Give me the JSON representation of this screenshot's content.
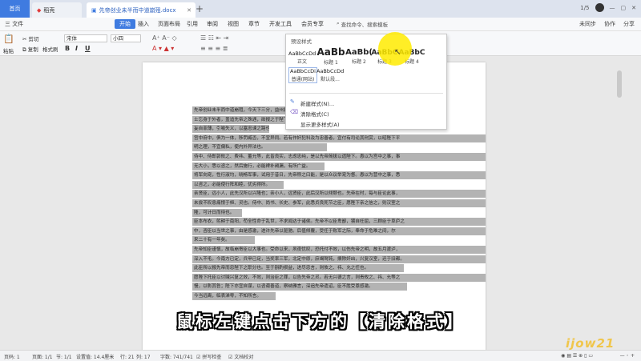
{
  "titlebar": {
    "home_tab": "首页",
    "docer_tab": "稻壳",
    "doc_tab": "先帝创业未半而中道崩殂.docx",
    "right_badge": "1/5",
    "sign_in": "(登录)"
  },
  "menubar": {
    "items": [
      "三 文件",
      "开始",
      "插入",
      "页面布局",
      "引用",
      "审阅",
      "视图",
      "章节",
      "开发工具",
      "会员专享"
    ],
    "search": "查找命令、搜索模板",
    "right": [
      "未同步",
      "协作",
      "分享"
    ]
  },
  "ribbon": {
    "cut": "剪切",
    "copy": "复制",
    "paste": "粘贴",
    "format_painter": "格式刷",
    "font_name": "宋体",
    "font_size": "小四",
    "bold": "B",
    "italic": "I",
    "underline": "U"
  },
  "styles_panel": {
    "header": "预设样式",
    "row1": [
      {
        "sample": "AaBbCcDd",
        "label": "正文"
      },
      {
        "sample": "AaBb",
        "label": "标题 1"
      },
      {
        "sample": "AaBb(",
        "label": "标题 2"
      },
      {
        "sample": "AaBbC",
        "label": "标题 3"
      },
      {
        "sample": "AaBbC",
        "label": "标题 4"
      }
    ],
    "row2": [
      {
        "sample": "AaBbCcDi",
        "label": "普通(网站)"
      },
      {
        "sample": "AaBbCcDd",
        "label": "默认段..."
      }
    ],
    "menu": [
      "新建样式(N)...",
      "清除格式(C)",
      "显示更多样式(A)"
    ]
  },
  "document": {
    "lines": [
      "先帝创业未半而中道崩殂，今天下三分，益州疲弊，此诚危急存",
      "士忘身于外者，盖追先帝之殊遇，欲报之于陛下也。诚宜开张圣听",
      "妄自菲薄，引喻失义，以塞忠谏之路也。",
      "宫中府中，俱为一体，陟罚臧否，不宜异同。若有作奸犯科及为忠善者，宜付有司论其刑赏，以昭陛下平",
      "明之理，不宜偏私，使内外异法也。",
      "侍中、侍郎郭攸之、费祎、董允等，此皆良实，志虑忠纯，是以先帝简拔以遗陛下。愚以为宫中之事，事",
      "无大小，悉以咨之，然后施行，必能裨补阙漏，有所广益。",
      "将军向宠，性行淑均，晓畅军事，试用于昔日，先帝称之曰能，是以众议举宠为督。愚以为营中之事，悉",
      "以咨之，必能使行阵和睦，优劣得所。",
      "亲贤臣，远小人，此先汉所以兴隆也；亲小人，远贤臣，此后汉所以倾颓也。先帝在时，每与臣论此事，",
      "未尝不叹息痛恨于桓、灵也。侍中、尚书、长史、参军，此悉贞良死节之臣，愿陛下亲之信之，则汉室之",
      "隆，可计日而待也。",
      "臣本布衣，躬耕于南阳，苟全性命于乱世，不求闻达于诸侯。先帝不以臣卑鄙，猥自枉屈，三顾臣于草庐之",
      "中，咨臣以当世之事，由是感激，遂许先帝以驱驰。后值倾覆，受任于败军之际，奉命于危难之间，尔",
      "来二十有一年矣。",
      "先帝知臣谨慎，故临崩寄臣以大事也。受命以来，夙夜忧叹，恐托付不效，以伤先帝之明，故五月渡泸，",
      "深入不毛。今南方已定，兵甲已足，当奖率三军，北定中原，庶竭驽钝，攘除奸凶，兴复汉室，还于旧都。",
      "此臣所以报先帝而忠陛下之职分也。至于斟酌损益，进尽忠言，则攸之、祎、允之任也。",
      "愿陛下托臣以讨贼兴复之效，不效，则治臣之罪，以告先帝之灵。若无兴德之言，则责攸之、祎、允等之",
      "慢，以彰其咎；陛下亦宜自谋，以咨诹善道，察纳雅言，深追先帝遗诏，臣不胜受恩感激。",
      "今当远离，临表涕零，不知所言。"
    ]
  },
  "caption": "鼠标左键点击下方的【清除格式】",
  "statusbar": {
    "page": "页码: 1",
    "pages": "页面: 1/1",
    "section": "节: 1/1",
    "setting": "设置值: 14.4厘米",
    "row": "行: 21",
    "col": "列: 17",
    "words": "字数: 741/741",
    "spell": "拼写检查",
    "proof": "文档校对"
  },
  "watermark": "ijow21"
}
